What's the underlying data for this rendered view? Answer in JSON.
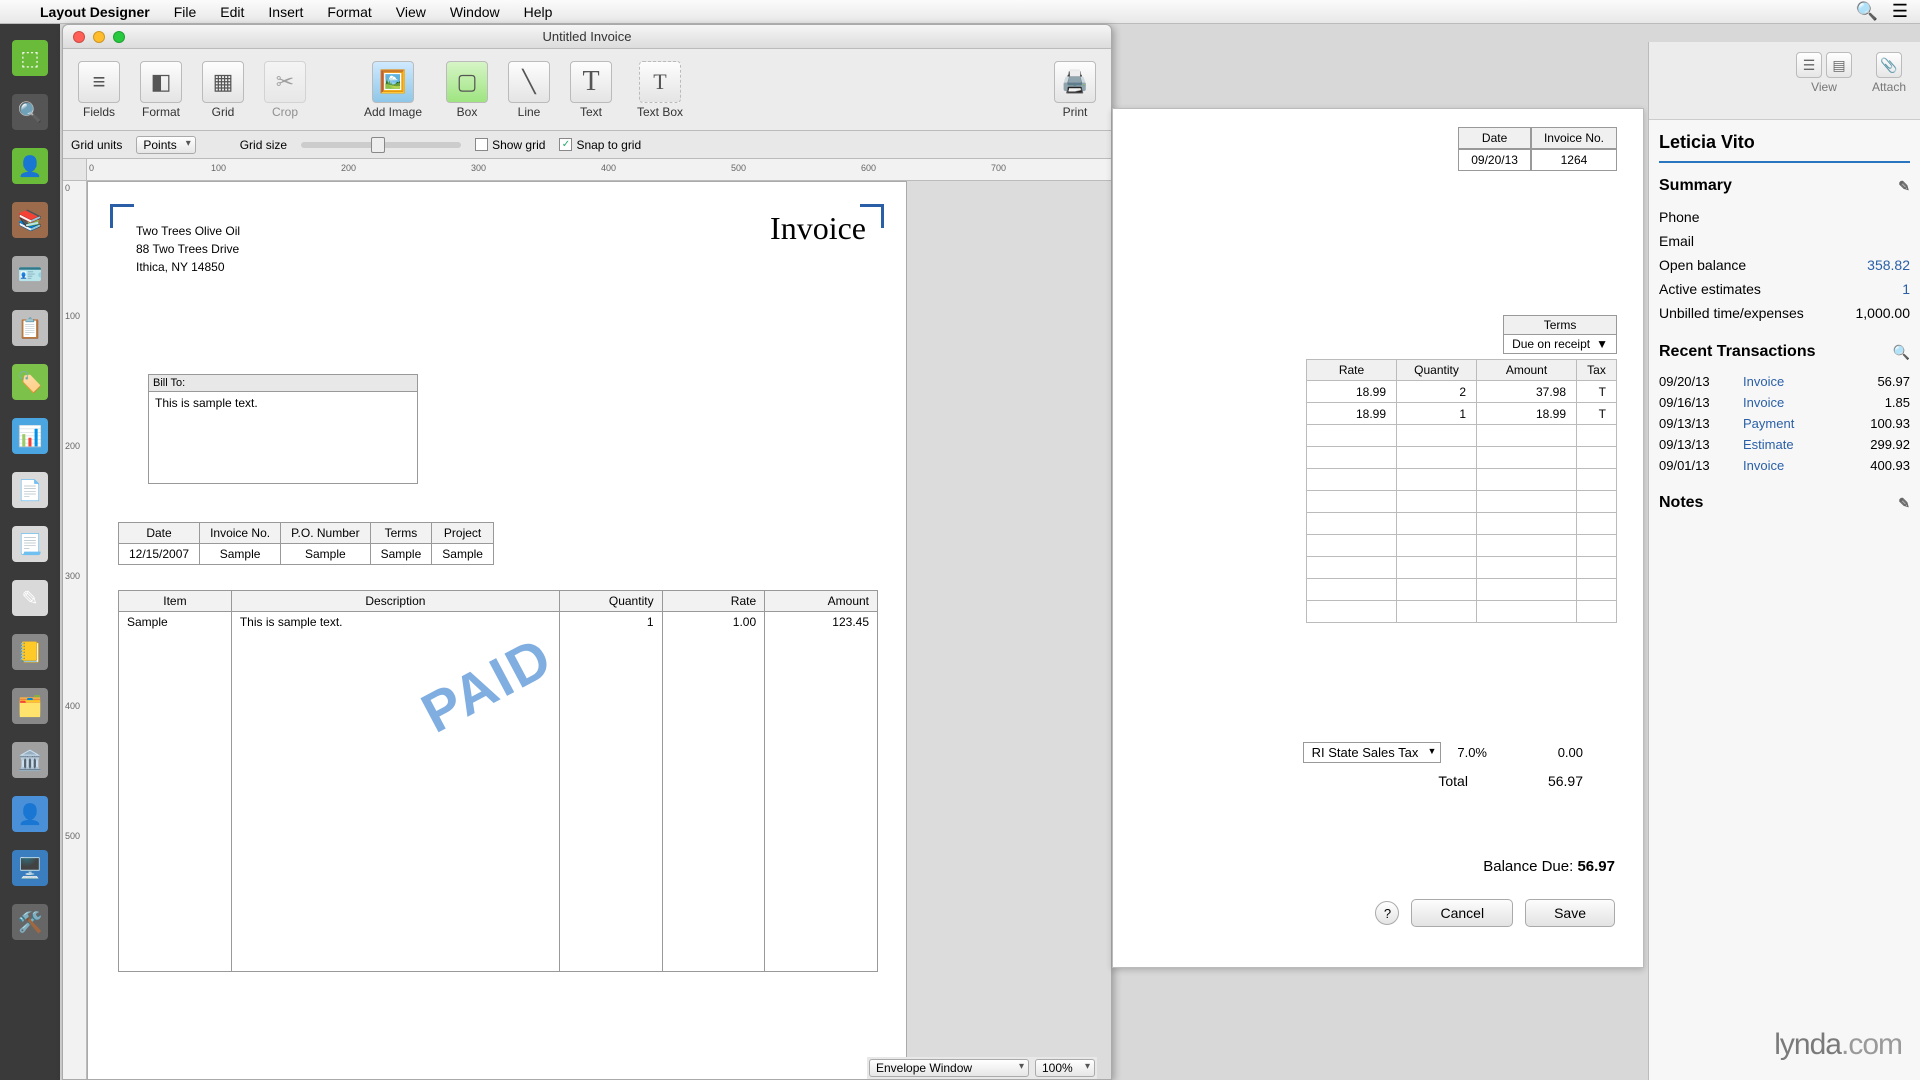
{
  "menubar": {
    "app": "Layout Designer",
    "items": [
      "File",
      "Edit",
      "Insert",
      "Format",
      "View",
      "Window",
      "Help"
    ]
  },
  "window": {
    "title": "Untitled Invoice",
    "toolbar": {
      "fields": "Fields",
      "format": "Format",
      "grid": "Grid",
      "crop": "Crop",
      "add_image": "Add Image",
      "box": "Box",
      "line": "Line",
      "text": "Text",
      "text_box": "Text Box",
      "print": "Print"
    },
    "gridbar": {
      "units_label": "Grid units",
      "units_value": "Points",
      "size_label": "Grid size",
      "show_grid": "Show grid",
      "snap": "Snap to grid"
    },
    "footer": {
      "template": "Envelope Window",
      "zoom": "100%"
    }
  },
  "invoice_layout": {
    "title": "Invoice",
    "company": {
      "name": "Two Trees Olive Oil",
      "addr1": "88 Two Trees Drive",
      "addr2": "Ithica, NY 14850"
    },
    "bill_to_label": "Bill To:",
    "bill_to_sample": "This is sample text.",
    "meta_headers": [
      "Date",
      "Invoice No.",
      "P.O. Number",
      "Terms",
      "Project"
    ],
    "meta_values": [
      "12/15/2007",
      "Sample",
      "Sample",
      "Sample",
      "Sample"
    ],
    "line_headers": [
      "Item",
      "Description",
      "Quantity",
      "Rate",
      "Amount"
    ],
    "line_sample": {
      "item": "Sample",
      "desc": "This is sample text.",
      "qty": "1",
      "rate": "1.00",
      "amount": "123.45"
    },
    "stamp": "PAID"
  },
  "bg_invoice": {
    "date_label": "Date",
    "date_value": "09/20/13",
    "invno_label": "Invoice No.",
    "invno_value": "1264",
    "terms_label": "Terms",
    "terms_value": "Due on receipt",
    "col_rate": "Rate",
    "col_qty": "Quantity",
    "col_amount": "Amount",
    "col_tax": "Tax",
    "rows": [
      {
        "rate": "18.99",
        "qty": "2",
        "amount": "37.98",
        "tax": "T"
      },
      {
        "rate": "18.99",
        "qty": "1",
        "amount": "18.99",
        "tax": "T"
      }
    ],
    "tax_item": "RI State Sales Tax",
    "tax_rate": "7.0%",
    "tax_amount": "0.00",
    "total_label": "Total",
    "total_value": "56.97",
    "balance_label": "Balance Due:",
    "balance_value": "56.97",
    "cancel": "Cancel",
    "save": "Save"
  },
  "sidebar": {
    "view_label": "View",
    "attach_label": "Attach",
    "customer": "Leticia Vito",
    "summary_label": "Summary",
    "fields": {
      "phone_label": "Phone",
      "email_label": "Email",
      "open_balance_label": "Open balance",
      "open_balance": "358.82",
      "active_est_label": "Active estimates",
      "active_est": "1",
      "unbilled_label": "Unbilled time/expenses",
      "unbilled": "1,000.00"
    },
    "recent_label": "Recent Transactions",
    "transactions": [
      {
        "date": "09/20/13",
        "type": "Invoice",
        "amount": "56.97"
      },
      {
        "date": "09/16/13",
        "type": "Invoice",
        "amount": "1.85"
      },
      {
        "date": "09/13/13",
        "type": "Payment",
        "amount": "100.93"
      },
      {
        "date": "09/13/13",
        "type": "Estimate",
        "amount": "299.92"
      },
      {
        "date": "09/01/13",
        "type": "Invoice",
        "amount": "400.93"
      }
    ],
    "notes_label": "Notes"
  },
  "brand": "lynda.com"
}
